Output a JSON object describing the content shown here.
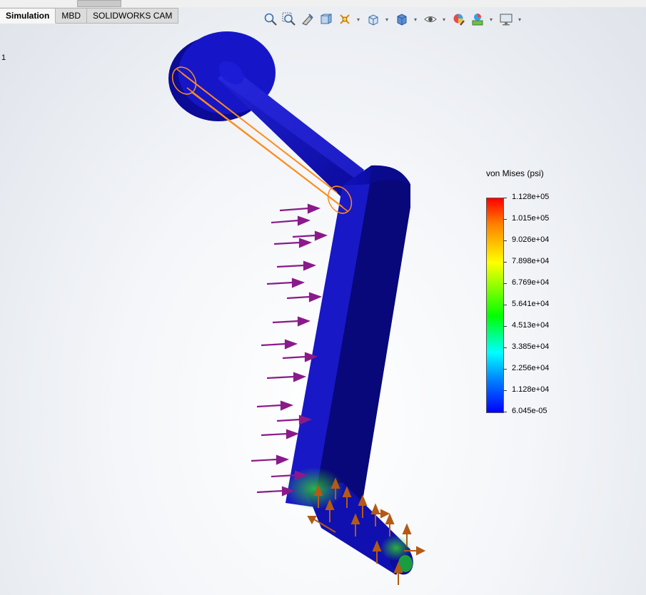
{
  "tabs": [
    {
      "label": "Simulation",
      "active": true
    },
    {
      "label": "MBD",
      "active": false
    },
    {
      "label": "SOLIDWORKS CAM",
      "active": false
    }
  ],
  "toolbar": {
    "icons": [
      "zoom-to-fit-icon",
      "zoom-to-area-icon",
      "previous-view-icon",
      "section-view-icon",
      "dynamic-annotation-icon",
      "view-orientation-icon",
      "display-style-icon",
      "hide-show-items-icon",
      "edit-appearance-icon",
      "apply-scene-icon",
      "view-settings-icon"
    ]
  },
  "side_number": "1",
  "legend": {
    "title": "von Mises (psi)",
    "values": [
      "1.128e+05",
      "1.015e+05",
      "9.026e+04",
      "7.898e+04",
      "6.769e+04",
      "5.641e+04",
      "4.513e+04",
      "3.385e+04",
      "2.256e+04",
      "1.128e+04",
      "6.045e-05"
    ]
  },
  "colors": {
    "part_blue": "#1414c8",
    "fixture_orange": "#ff8c1a",
    "force_purple": "#8a1a8a",
    "restraint_brown": "#b45a14",
    "stress_green": "#22cc22"
  }
}
